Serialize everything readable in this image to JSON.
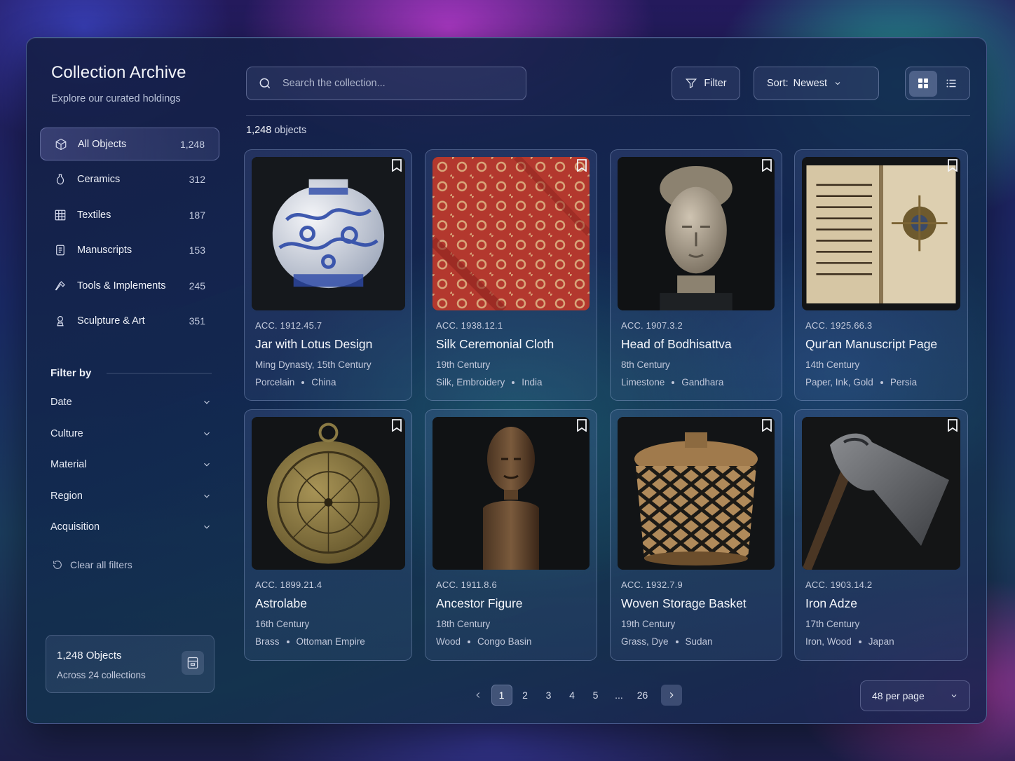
{
  "app": {
    "title": "Collection Archive",
    "subtitle": "Explore our curated holdings"
  },
  "categories": [
    {
      "label": "All Objects",
      "count": "1,248",
      "icon": "cube-icon",
      "active": true
    },
    {
      "label": "Ceramics",
      "count": "312",
      "icon": "vase-icon"
    },
    {
      "label": "Textiles",
      "count": "187",
      "icon": "textile-grid-icon"
    },
    {
      "label": "Manuscripts",
      "count": "153",
      "icon": "document-icon"
    },
    {
      "label": "Tools & Implements",
      "count": "245",
      "icon": "hammer-icon"
    },
    {
      "label": "Sculpture & Art",
      "count": "351",
      "icon": "bust-icon"
    }
  ],
  "filters": {
    "heading": "Filter by",
    "facets": [
      "Date",
      "Culture",
      "Material",
      "Region",
      "Acquisition"
    ],
    "clear_label": "Clear all filters"
  },
  "summary": {
    "title": "1,248 Objects",
    "subtitle": "Across 24 collections"
  },
  "toolbar": {
    "search_placeholder": "Search the collection...",
    "filter_label": "Filter",
    "sort_prefix": "Sort:",
    "sort_value": "Newest",
    "view_mode": "grid"
  },
  "results": {
    "count": "1,248",
    "count_suffix": " objects"
  },
  "objects": [
    {
      "acc": "ACC. 1912.45.7",
      "title": "Jar with Lotus Design",
      "date": "Ming Dynasty, 15th Century",
      "material": "Porcelain",
      "origin": "China",
      "image": "blue-white-porcelain-jar"
    },
    {
      "acc": "ACC. 1938.12.1",
      "title": "Silk Ceremonial Cloth",
      "date": "19th Century",
      "material": "Silk, Embroidery",
      "origin": "India",
      "image": "red-embroidered-cloth"
    },
    {
      "acc": "ACC. 1907.3.2",
      "title": "Head of Bodhisattva",
      "date": "8th Century",
      "material": "Limestone",
      "origin": "Gandhara",
      "image": "stone-head-sculpture"
    },
    {
      "acc": "ACC. 1925.66.3",
      "title": "Qur'an Manuscript Page",
      "date": "14th Century",
      "material": "Paper, Ink, Gold",
      "origin": "Persia",
      "image": "open-manuscript"
    },
    {
      "acc": "ACC. 1899.21.4",
      "title": "Astrolabe",
      "date": "16th Century",
      "material": "Brass",
      "origin": "Ottoman Empire",
      "image": "brass-astrolabe"
    },
    {
      "acc": "ACC. 1911.8.6",
      "title": "Ancestor Figure",
      "date": "18th Century",
      "material": "Wood",
      "origin": "Congo Basin",
      "image": "carved-wood-figure"
    },
    {
      "acc": "ACC. 1932.7.9",
      "title": "Woven Storage Basket",
      "date": "19th Century",
      "material": "Grass, Dye",
      "origin": "Sudan",
      "image": "woven-basket"
    },
    {
      "acc": "ACC. 1903.14.2",
      "title": "Iron Adze",
      "date": "17th Century",
      "material": "Iron, Wood",
      "origin": "Japan",
      "image": "iron-adze"
    }
  ],
  "pagination": {
    "pages": [
      "1",
      "2",
      "3",
      "4",
      "5",
      "...",
      "26"
    ],
    "current": "1",
    "per_page": "48 per page"
  },
  "colors": {
    "frame_border": "#a0beff",
    "accent": "#e8ecf6"
  }
}
